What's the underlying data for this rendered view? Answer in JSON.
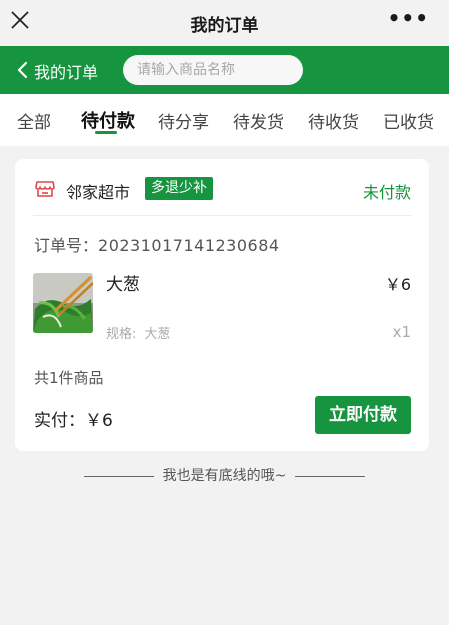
{
  "titlebar": {
    "title": "我的订单",
    "more": "•••"
  },
  "greenbar": {
    "back_label": "我的订单",
    "search_placeholder": "请输入商品名称"
  },
  "tabs": [
    {
      "label": "全部"
    },
    {
      "label": "待付款"
    },
    {
      "label": "待分享"
    },
    {
      "label": "待发货"
    },
    {
      "label": "待收货"
    },
    {
      "label": "已收货"
    }
  ],
  "active_tab": "待付款",
  "order": {
    "store_name": "邻家超市",
    "badge": "多退少补",
    "status": "未付款",
    "order_no_label": "订单号：",
    "order_no": "20231017141230684",
    "product": {
      "name": "大葱",
      "price": "￥6",
      "spec_label": "规格:",
      "spec_value": "大葱",
      "qty": "x1"
    },
    "count_text": "共1件商品",
    "paid_label": "实付：",
    "paid_value": "￥6",
    "pay_button": "立即付款"
  },
  "footer_note": "我也是有底线的哦~",
  "colors": {
    "brand_green": "#17943f",
    "background": "#f2f2f2"
  }
}
